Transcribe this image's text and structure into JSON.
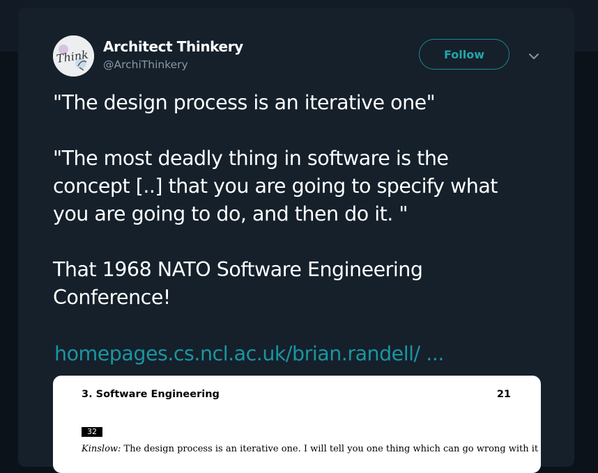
{
  "author": {
    "display_name": "Architect Thinkery",
    "handle": "@ArchiThinkery",
    "avatar_text": "Think"
  },
  "actions": {
    "follow_label": "Follow",
    "menu_icon": "chevron-down-icon"
  },
  "tweet": {
    "lines": [
      "\"The design process is an iterative one\"",
      "\"The most deadly thing in software is the",
      "concept [..] that you are going to specify what",
      "you are going to do, and then do it. \"",
      "That 1968 NATO Software Engineering",
      "Conference!"
    ],
    "link_text": "homepages.cs.ncl.ac.uk/brian.randell/ ..."
  },
  "preview": {
    "section_title": "3. Software Engineering",
    "page_number": "21",
    "badge": "32",
    "speaker": "Kinslow:",
    "excerpt": " The design process is an iterative one. I will tell you one thing which can go wrong with it if you are not in"
  },
  "colors": {
    "background": "#0b121a",
    "card": "#15202b",
    "accent": "#1b95a0",
    "secondary_text": "#8899a6"
  }
}
